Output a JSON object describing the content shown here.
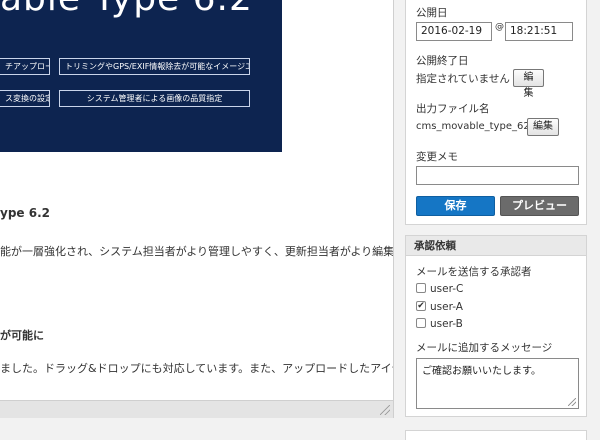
{
  "banner": {
    "title": "able Type 6.2",
    "chips": [
      "チアップロード",
      "トリミングやGPS/EXIF情報除去が可能なイメージエディタ",
      "ス変換の設定",
      "システム管理者による画像の品質指定"
    ]
  },
  "document": {
    "heading_version": "ype 6.2",
    "paragraph1": "能が一層強化され、システム担当者がより管理しやすく、更新担当者がより編集",
    "heading_upload": "が可能に",
    "paragraph2": "ました。ドラッグ&ドロップにも対応しています。また、アップロードしたアイテ"
  },
  "publish": {
    "date_label": "公開日",
    "date_value": "2016-02-19",
    "at_symbol": "@",
    "time_value": "18:21:51",
    "end_label": "公開終了日",
    "end_value": "指定されていません",
    "end_edit": "編集",
    "filename_label": "出力ファイル名",
    "filename_value": "cms_movable_type_62",
    "filename_edit": "編集",
    "memo_label": "変更メモ",
    "memo_value": "",
    "save": "保存",
    "preview": "プレビュー"
  },
  "approval": {
    "title": "承認依頼",
    "approvers_label": "メールを送信する承認者",
    "approvers": [
      {
        "name": "user-C",
        "checked": false
      },
      {
        "name": "user-A",
        "checked": true
      },
      {
        "name": "user-B",
        "checked": false
      }
    ],
    "message_label": "メールに追加するメッセージ",
    "message_value": "ご確認お願いいたします。"
  },
  "colors": {
    "banner_bg": "#0d2450",
    "save_bg": "#1576c5",
    "preview_bg": "#6b6b6b"
  }
}
